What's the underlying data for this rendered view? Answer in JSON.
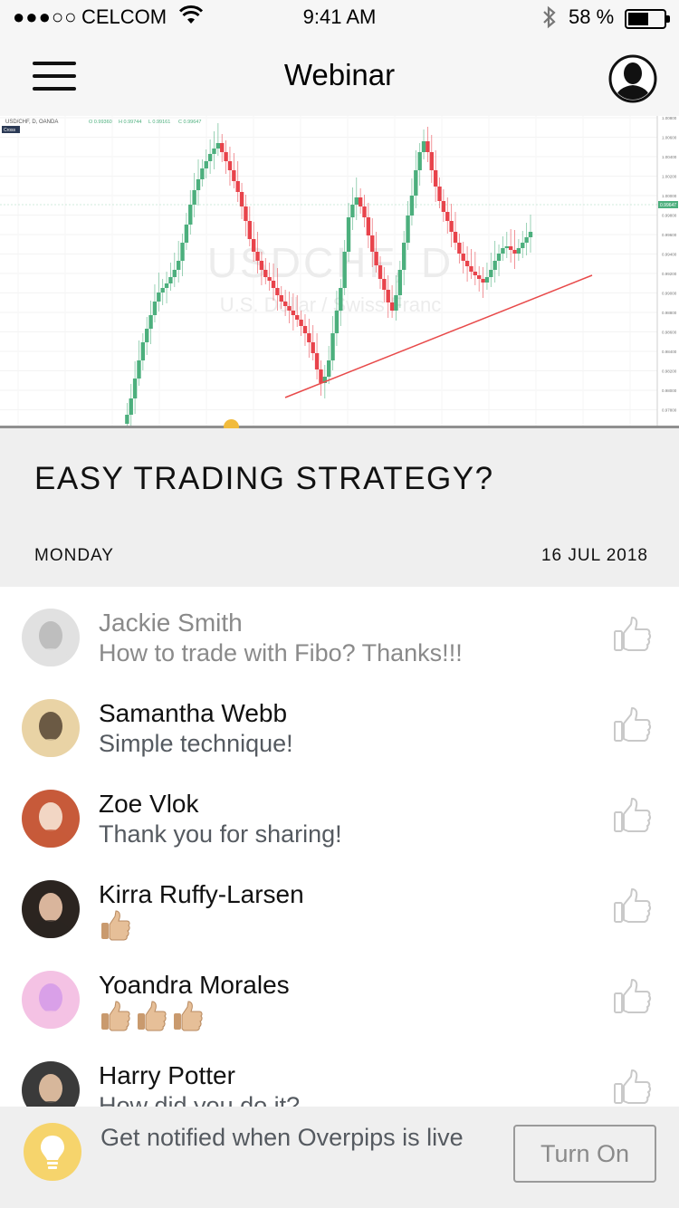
{
  "status_bar": {
    "signal": "●●●○○",
    "carrier": "CELCOM",
    "time": "9:41 AM",
    "battery": "58 %",
    "battery_level": 0.58
  },
  "header": {
    "title": "Webinar",
    "menu_icon": "hamburger-menu-icon",
    "profile_icon": "user-avatar-icon"
  },
  "chart": {
    "symbol_header": "USD/CHF, D, OANDA",
    "ohlc": [
      "O 0.99360",
      "H 0.99744",
      "L 0.99161",
      "C 0.99647"
    ],
    "cross_label": "Cross",
    "watermark_symbol": "USDCHF, D",
    "watermark_name": "U.S. Dollar / Swiss Franc",
    "current_price": "0.99647",
    "price_ticks": [
      "1.00800",
      "1.00600",
      "1.00400",
      "1.00200",
      "1.00000",
      "0.99800",
      "0.99600",
      "0.99400",
      "0.99200",
      "0.99000",
      "0.98800",
      "0.98600",
      "0.98400",
      "0.98200",
      "0.98000",
      "0.97800"
    ],
    "up_color": "#4caf7d",
    "down_color": "#e8434b",
    "trendline_color": "#e84a4a",
    "playback_progress": 0.34
  },
  "webinar": {
    "title": "EASY TRADING STRATEGY?",
    "day": "MONDAY",
    "date": "16 JUL 2018"
  },
  "comments": [
    {
      "name": "Jackie Smith",
      "text": "How to trade with Fibo? Thanks!!!",
      "emoji_count": 0,
      "avatar_colors": [
        "#c9c9c9",
        "#8a8a8a"
      ]
    },
    {
      "name": "Samantha Webb",
      "text": "Simple technique!",
      "emoji_count": 0,
      "avatar_colors": [
        "#e9d3a5",
        "#6b5a44"
      ]
    },
    {
      "name": "Zoe Vlok",
      "text": "Thank you for sharing!",
      "emoji_count": 0,
      "avatar_colors": [
        "#c75a3a",
        "#f2d6c4"
      ]
    },
    {
      "name": "Kirra Ruffy-Larsen",
      "text": "",
      "emoji_count": 1,
      "avatar_colors": [
        "#2b2420",
        "#d9b59c"
      ]
    },
    {
      "name": "Yoandra Morales",
      "text": "",
      "emoji_count": 3,
      "avatar_colors": [
        "#f4c2e4",
        "#d9a0e8"
      ]
    },
    {
      "name": "Harry Potter",
      "text": "How did you do it?",
      "emoji_count": 0,
      "avatar_colors": [
        "#3a3a3a",
        "#d7b79b"
      ]
    }
  ],
  "notify": {
    "text": "Get notified when Overpips is live",
    "button_label": "Turn On",
    "bulb_icon": "lightbulb-icon"
  }
}
